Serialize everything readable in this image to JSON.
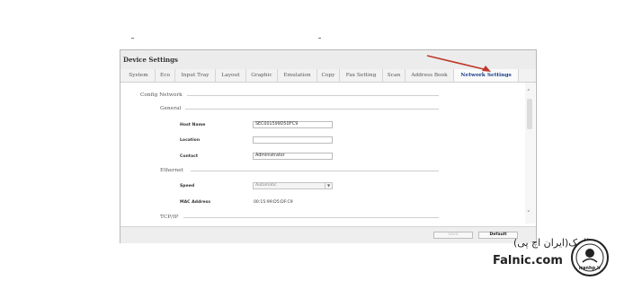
{
  "window": {
    "title": "Device Settings"
  },
  "tabs": [
    {
      "label": "System"
    },
    {
      "label": "Eco"
    },
    {
      "label": "Input Tray"
    },
    {
      "label": "Layout"
    },
    {
      "label": "Graphic"
    },
    {
      "label": "Emulation"
    },
    {
      "label": "Copy"
    },
    {
      "label": "Fax Setting"
    },
    {
      "label": "Scan"
    },
    {
      "label": "Address Book"
    },
    {
      "label": "Network Settings",
      "active": true
    }
  ],
  "config": {
    "section_title": "Config Network",
    "general": {
      "title": "General",
      "host_name_label": "Host Name",
      "host_name_value": "SEC001599D5DFC9",
      "location_label": "Location",
      "location_value": "",
      "contact_label": "Contact",
      "contact_value": "Administrator"
    },
    "ethernet": {
      "title": "Ethernet",
      "speed_label": "Speed",
      "speed_value": "Automatic",
      "mac_label": "MAC Address",
      "mac_value": "00:15:99:D5:DF:C9"
    },
    "tcpip": {
      "title": "TCP/IP"
    }
  },
  "footer": {
    "save_label": "Save",
    "default_label": "Default"
  },
  "watermark": {
    "brand_fa": "فالنیک(ایران اچ پی)",
    "brand_en": "Falnic.com",
    "logo_text": "iranhp.ir"
  },
  "annotation": {
    "arrow_color": "#c0392b"
  },
  "icons": {
    "scroll_up": "chevron-up-icon",
    "scroll_down": "chevron-down-icon",
    "select_arrow": "triangle-down-icon"
  }
}
